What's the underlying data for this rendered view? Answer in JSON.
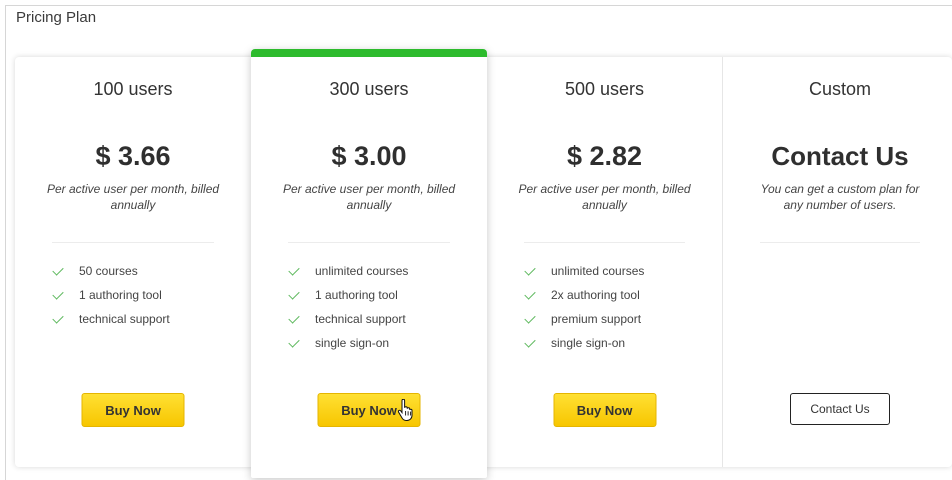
{
  "page": {
    "title": "Pricing Plan"
  },
  "colors": {
    "accent_green": "#2dbb2d",
    "buy_yellow": "#ffd200",
    "check_green": "#5cb85c"
  },
  "plans": [
    {
      "name": "100 users",
      "price": "$ 3.66",
      "note": "Per active user per month, billed annually",
      "features": [
        "50 courses",
        "1 authoring tool",
        "technical support"
      ],
      "cta": "Buy Now"
    },
    {
      "name": "300 users",
      "price": "$ 3.00",
      "note": "Per active user per month, billed annually",
      "features": [
        "unlimited courses",
        "1 authoring tool",
        "technical support",
        "single sign-on"
      ],
      "cta": "Buy Now"
    },
    {
      "name": "500 users",
      "price": "$ 2.82",
      "note": "Per active user per month, billed annually",
      "features": [
        "unlimited courses",
        "2x authoring tool",
        "premium support",
        "single sign-on"
      ],
      "cta": "Buy Now"
    },
    {
      "name": "Custom",
      "price": "Contact Us",
      "note": "You can get a custom plan for any number of users.",
      "features": [],
      "cta": "Contact Us"
    }
  ],
  "icons": {
    "check": "check-icon",
    "cursor": "hand-pointer-icon"
  }
}
